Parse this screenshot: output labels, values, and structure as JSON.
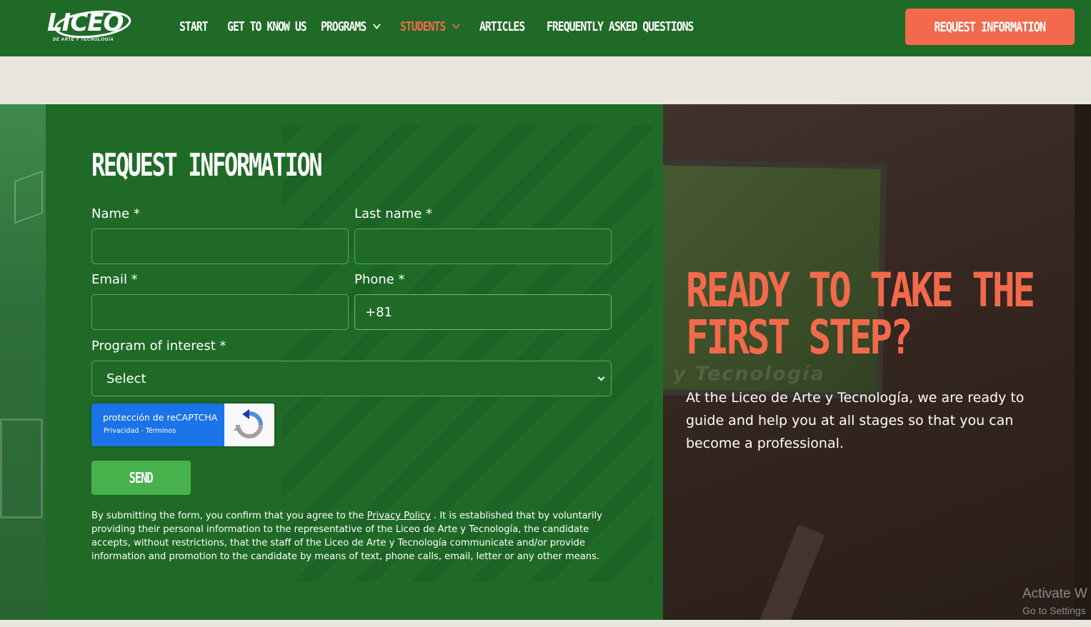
{
  "header": {
    "logo_text": "LICEO",
    "logo_subtitle": "DE ARTE Y TECNOLOGÍA",
    "nav": [
      {
        "label": "START",
        "dropdown": false
      },
      {
        "label": "GET TO KNOW US",
        "dropdown": false
      },
      {
        "label": "PROGRAMS",
        "dropdown": true
      },
      {
        "label": "STUDENTS",
        "dropdown": true,
        "active": true
      },
      {
        "label": "ARTICLES",
        "dropdown": false
      },
      {
        "label": "FREQUENTLY ASKED QUESTIONS",
        "dropdown": false
      }
    ],
    "cta_label": "REQUEST INFORMATION"
  },
  "form": {
    "title": "REQUEST INFORMATION",
    "name_label": "Name *",
    "name_value": "",
    "lastname_label": "Last name *",
    "lastname_value": "",
    "email_label": "Email *",
    "email_value": "",
    "phone_label": "Phone *",
    "phone_value": "+81",
    "program_label": "Program of interest *",
    "program_value": "Select",
    "captcha_text": "protección de reCAPTCHA",
    "captcha_links": "Privacidad - Términos",
    "send_label": "SEND",
    "disclaimer_before": "By submitting the form, you confirm that you agree to the ",
    "disclaimer_link": "Privacy Policy",
    "disclaimer_after": " . It is established that by voluntarily providing their personal information to the representative of the Liceo de Arte y Tecnología, the candidate accepts, without restrictions, that the staff of the Liceo de Arte y Tecnología communicate and/or provide information and promotion to the candidate by means of text, phone calls, email, letter or any other means."
  },
  "hero": {
    "heading_line1": "READY TO TAKE THE",
    "heading_line2": "FIRST STEP?",
    "background_text": "y Tecnología",
    "text": "At the Liceo de Arte y Tecnología, we are ready to guide and help you at all stages so that you can become a professional."
  },
  "os_overlay": {
    "title": "Activate W",
    "subtitle": "Go to Settings"
  },
  "colors": {
    "brand_green": "#1f6a27",
    "accent_orange": "#f26a4b",
    "send_green": "#47b14b",
    "captcha_blue": "#1a73e8"
  }
}
